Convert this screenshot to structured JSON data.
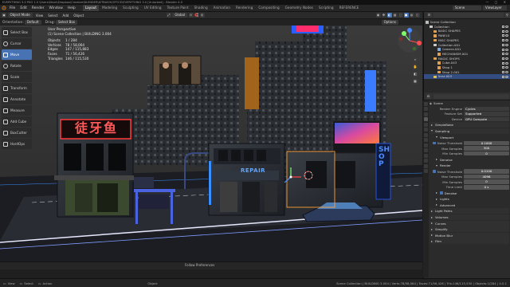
{
  "window": {
    "title": "EVERYTHING 3.0 PKG 1.0 \\Users\\Stack\\Dropbox\\Creative\\BLENDER\\KITBASH\\OFFICE\\EVERYTHING 3.0 [Unlocked] - Blender 4.0",
    "controls": "— ▢ ✕"
  },
  "menubar": {
    "menus": [
      "File",
      "Edit",
      "Render",
      "Window",
      "Help"
    ],
    "workspaces": [
      "Layout",
      "Modeling",
      "Sculpting",
      "UV Editing",
      "Texture Paint",
      "Shading",
      "Animation",
      "Rendering",
      "Compositing",
      "Geometry Nodes",
      "Scripting",
      "REFERENCE"
    ],
    "active_workspace": "Layout",
    "scene": "Scene",
    "view_layer": "ViewLayer"
  },
  "viewport_header": {
    "mode": "Object Mode",
    "menus": [
      "View",
      "Select",
      "Add",
      "Object"
    ],
    "transform": "Global",
    "orientation_label": "Orientation:",
    "orientation_value": "Default",
    "drag_label": "Drag:",
    "drag_value": "Select Box",
    "options": "Options"
  },
  "toolbar": {
    "tools": [
      "Select Box",
      "Cursor",
      "Move",
      "Rotate",
      "Scale",
      "Transform",
      "Annotate",
      "Measure",
      "Add Cube",
      "BoxCutter",
      "HardOps"
    ],
    "active_tool": "Move"
  },
  "overlay": {
    "view": "User Perspective",
    "collection": "(1) Scene Collection | BUILDING 3.004",
    "stats": [
      {
        "k": "Objects",
        "v": "1 / 284"
      },
      {
        "k": "Vertices",
        "v": "78 / 58,064"
      },
      {
        "k": "Edges",
        "v": "147 / 115,883"
      },
      {
        "k": "Faces",
        "v": "71 / 56,426"
      },
      {
        "k": "Triangles",
        "v": "146 / 115,530"
      }
    ]
  },
  "scene_signs": {
    "chinese": "徒牙鱼",
    "repair": "REPAIR",
    "shop": "SHOP"
  },
  "timeline": {
    "popup": "Follow Preferences"
  },
  "statusbar": {
    "items": [
      "View",
      "Select",
      "Action"
    ],
    "mode_label": "Object",
    "info": "Scene Collection | BUILDING 3.004 | Verts:78/58,064 | Faces:71/56,426 | Tris:146/115,530 | Objects:1/284 | 4.0.1"
  },
  "outliner": {
    "title": "Scene Collection",
    "items": [
      {
        "label": "Collection",
        "indent": 0,
        "color": "#c8c8c8",
        "selected": false
      },
      {
        "label": "BASIC SHAPES",
        "indent": 1,
        "color": "#e0a050",
        "selected": false
      },
      {
        "label": "PANELS",
        "indent": 1,
        "color": "#e0a050",
        "selected": false
      },
      {
        "label": "MISC SHAPES",
        "indent": 1,
        "color": "#e0a050",
        "selected": false
      },
      {
        "label": "Collection.001",
        "indent": 1,
        "color": "#c8c8c8",
        "selected": false
      },
      {
        "label": "Camera.001",
        "indent": 2,
        "color": "#7ca8e0",
        "selected": false
      },
      {
        "label": "MECHANISM.001",
        "indent": 2,
        "color": "#e0a050",
        "selected": false
      },
      {
        "label": "MAGIC SHOPS",
        "indent": 1,
        "color": "#e0a050",
        "selected": false
      },
      {
        "label": "Cube.043",
        "indent": 2,
        "color": "#e0a050",
        "selected": false
      },
      {
        "label": "Shop 1",
        "indent": 2,
        "color": "#e0a050",
        "selected": false
      },
      {
        "label": "Shop 2.001",
        "indent": 2,
        "color": "#e0a050",
        "selected": false
      },
      {
        "label": "Area.003",
        "indent": 1,
        "color": "#e0c050",
        "selected": true
      }
    ]
  },
  "properties": {
    "tabs": 14,
    "active_tab": 3,
    "scene_label": "Scene",
    "render_engine_label": "Render Engine",
    "render_engine": "Cycles",
    "feature_set_label": "Feature Set",
    "feature_set": "Supported",
    "device_label": "Device",
    "device": "GPU Compute",
    "sections": [
      {
        "kind": "sec",
        "label": "SimpleBake",
        "open": false
      },
      {
        "kind": "sec",
        "label": "Sampling",
        "open": true
      },
      {
        "kind": "sub",
        "label": "Viewport",
        "open": true
      },
      {
        "kind": "check",
        "label": "Noise Threshold",
        "value": "0.1000",
        "on": true
      },
      {
        "kind": "field",
        "label": "Max Samples",
        "value": "300"
      },
      {
        "kind": "field",
        "label": "Min Samples",
        "value": "0"
      },
      {
        "kind": "sub",
        "label": "Denoise",
        "open": false
      },
      {
        "kind": "sub",
        "label": "Render",
        "open": true
      },
      {
        "kind": "check",
        "label": "Noise Threshold",
        "value": "0.0100",
        "on": true
      },
      {
        "kind": "field",
        "label": "Max Samples",
        "value": "4096"
      },
      {
        "kind": "field",
        "label": "Min Samples",
        "value": "0"
      },
      {
        "kind": "field",
        "label": "Time Limit",
        "value": "0 s"
      },
      {
        "kind": "sub",
        "label": "Denoise",
        "open": false,
        "checked": true
      },
      {
        "kind": "sub",
        "label": "Lights",
        "open": false
      },
      {
        "kind": "sub",
        "label": "Advanced",
        "open": false
      },
      {
        "kind": "sec",
        "label": "Light Paths",
        "open": false
      },
      {
        "kind": "sec",
        "label": "Volumes",
        "open": false
      },
      {
        "kind": "sec",
        "label": "Curves",
        "open": false
      },
      {
        "kind": "sec",
        "label": "Simplify",
        "open": false
      },
      {
        "kind": "sec",
        "label": "Motion Blur",
        "open": false
      },
      {
        "kind": "sec",
        "label": "Film",
        "open": false
      }
    ]
  },
  "colors": {
    "accent": "#4772b3",
    "panel": "#2b2b2b",
    "viewport": "#303030",
    "neon_red": "#ff3b3b",
    "neon_blue": "#39a7ff",
    "neon_green": "#7dff6a"
  }
}
